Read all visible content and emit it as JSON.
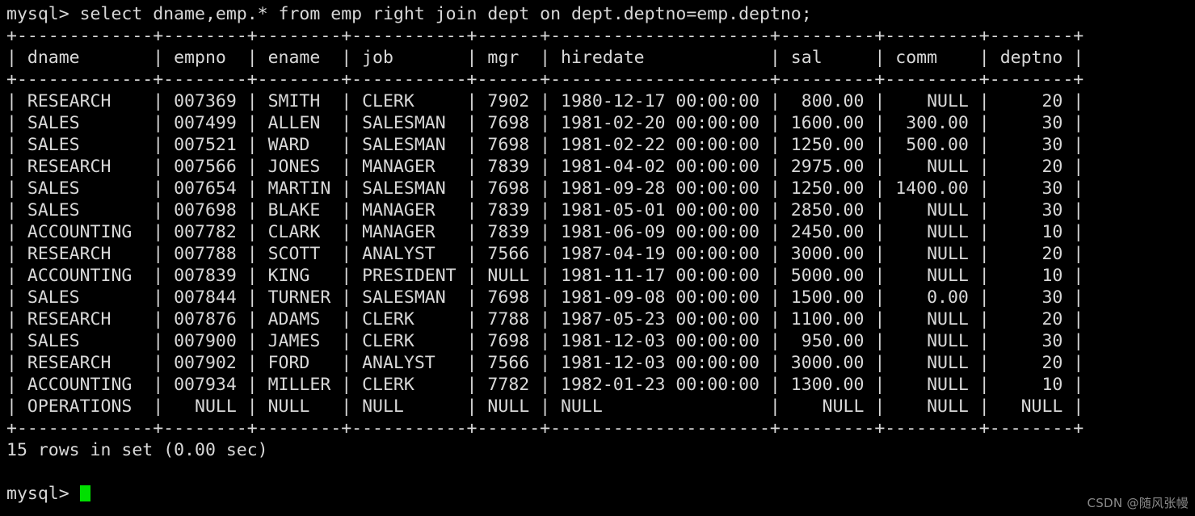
{
  "terminal": {
    "prompt": "mysql>",
    "query": "select dname,emp.* from emp right join dept on dept.deptno=emp.deptno;",
    "query_line": "mysql> select dname,emp.* from emp right join dept on dept.deptno=emp.deptno;",
    "status": "15 rows in set (0.00 sec)",
    "final_prompt": "mysql> ",
    "cursor": "block-cursor",
    "colors": {
      "background": "#000000",
      "foreground": "#d8d8d8",
      "cursor": "#00e000",
      "watermark": "#8a8a8a"
    }
  },
  "watermark": {
    "text": "CSDN @随风张幔"
  },
  "table": {
    "columns": [
      {
        "name": "dname",
        "width": 13,
        "align": "left"
      },
      {
        "name": "empno",
        "width": 8,
        "align": "right"
      },
      {
        "name": "ename",
        "width": 8,
        "align": "left"
      },
      {
        "name": "job",
        "width": 11,
        "align": "left"
      },
      {
        "name": "mgr",
        "width": 6,
        "align": "right"
      },
      {
        "name": "hiredate",
        "width": 21,
        "align": "left"
      },
      {
        "name": "sal",
        "width": 9,
        "align": "right"
      },
      {
        "name": "comm",
        "width": 9,
        "align": "right"
      },
      {
        "name": "deptno",
        "width": 8,
        "align": "right"
      }
    ],
    "rows": [
      [
        "RESEARCH",
        "007369",
        "SMITH",
        "CLERK",
        "7902",
        "1980-12-17 00:00:00",
        "800.00",
        "NULL",
        "20"
      ],
      [
        "SALES",
        "007499",
        "ALLEN",
        "SALESMAN",
        "7698",
        "1981-02-20 00:00:00",
        "1600.00",
        "300.00",
        "30"
      ],
      [
        "SALES",
        "007521",
        "WARD",
        "SALESMAN",
        "7698",
        "1981-02-22 00:00:00",
        "1250.00",
        "500.00",
        "30"
      ],
      [
        "RESEARCH",
        "007566",
        "JONES",
        "MANAGER",
        "7839",
        "1981-04-02 00:00:00",
        "2975.00",
        "NULL",
        "20"
      ],
      [
        "SALES",
        "007654",
        "MARTIN",
        "SALESMAN",
        "7698",
        "1981-09-28 00:00:00",
        "1250.00",
        "1400.00",
        "30"
      ],
      [
        "SALES",
        "007698",
        "BLAKE",
        "MANAGER",
        "7839",
        "1981-05-01 00:00:00",
        "2850.00",
        "NULL",
        "30"
      ],
      [
        "ACCOUNTING",
        "007782",
        "CLARK",
        "MANAGER",
        "7839",
        "1981-06-09 00:00:00",
        "2450.00",
        "NULL",
        "10"
      ],
      [
        "RESEARCH",
        "007788",
        "SCOTT",
        "ANALYST",
        "7566",
        "1987-04-19 00:00:00",
        "3000.00",
        "NULL",
        "20"
      ],
      [
        "ACCOUNTING",
        "007839",
        "KING",
        "PRESIDENT",
        "NULL",
        "1981-11-17 00:00:00",
        "5000.00",
        "NULL",
        "10"
      ],
      [
        "SALES",
        "007844",
        "TURNER",
        "SALESMAN",
        "7698",
        "1981-09-08 00:00:00",
        "1500.00",
        "0.00",
        "30"
      ],
      [
        "RESEARCH",
        "007876",
        "ADAMS",
        "CLERK",
        "7788",
        "1987-05-23 00:00:00",
        "1100.00",
        "NULL",
        "20"
      ],
      [
        "SALES",
        "007900",
        "JAMES",
        "CLERK",
        "7698",
        "1981-12-03 00:00:00",
        "950.00",
        "NULL",
        "30"
      ],
      [
        "RESEARCH",
        "007902",
        "FORD",
        "ANALYST",
        "7566",
        "1981-12-03 00:00:00",
        "3000.00",
        "NULL",
        "20"
      ],
      [
        "ACCOUNTING",
        "007934",
        "MILLER",
        "CLERK",
        "7782",
        "1982-01-23 00:00:00",
        "1300.00",
        "NULL",
        "10"
      ],
      [
        "OPERATIONS",
        "NULL",
        "NULL",
        "NULL",
        "NULL",
        "NULL",
        "NULL",
        "NULL",
        "NULL"
      ]
    ]
  }
}
